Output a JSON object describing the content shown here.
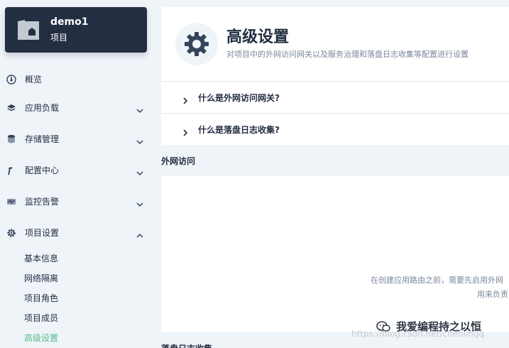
{
  "project": {
    "name": "demo1",
    "type": "项目"
  },
  "sidebar": {
    "items": [
      {
        "label": "概览",
        "icon": "dashboard-icon",
        "has_chevron": false
      },
      {
        "label": "应用负载",
        "icon": "layers-icon",
        "has_chevron": true,
        "chevron": "down"
      },
      {
        "label": "存储管理",
        "icon": "database-icon",
        "has_chevron": true,
        "chevron": "down"
      },
      {
        "label": "配置中心",
        "icon": "hammer-icon",
        "has_chevron": true,
        "chevron": "down"
      },
      {
        "label": "监控告警",
        "icon": "monitor-icon",
        "has_chevron": true,
        "chevron": "down"
      },
      {
        "label": "项目设置",
        "icon": "gear-icon",
        "has_chevron": true,
        "chevron": "up"
      }
    ],
    "sub_items": [
      {
        "label": "基本信息",
        "active": false
      },
      {
        "label": "网络隔离",
        "active": false
      },
      {
        "label": "项目角色",
        "active": false
      },
      {
        "label": "项目成员",
        "active": false
      },
      {
        "label": "高级设置",
        "active": true
      }
    ]
  },
  "header": {
    "title": "高级设置",
    "description": "对项目中的外网访问网关以及服务治理和落盘日志收集等配置进行设置"
  },
  "faq": [
    {
      "label": "什么是外网访问网关?"
    },
    {
      "label": "什么是落盘日志收集?"
    }
  ],
  "external_access": {
    "section_title": "外网访问",
    "empty_text_line1": "在创建应用路由之前，需要先启用外网",
    "empty_text_line2": "用来负责"
  },
  "log_collection": {
    "section_title": "落盘日志收集"
  },
  "watermark": {
    "url": "https://blog.csdn.net/chenlinqq",
    "text": "我爱编程持之以恒"
  },
  "colors": {
    "sidebar_card": "#242e42",
    "active_green": "#55bc8a",
    "background": "#eff4f9"
  }
}
